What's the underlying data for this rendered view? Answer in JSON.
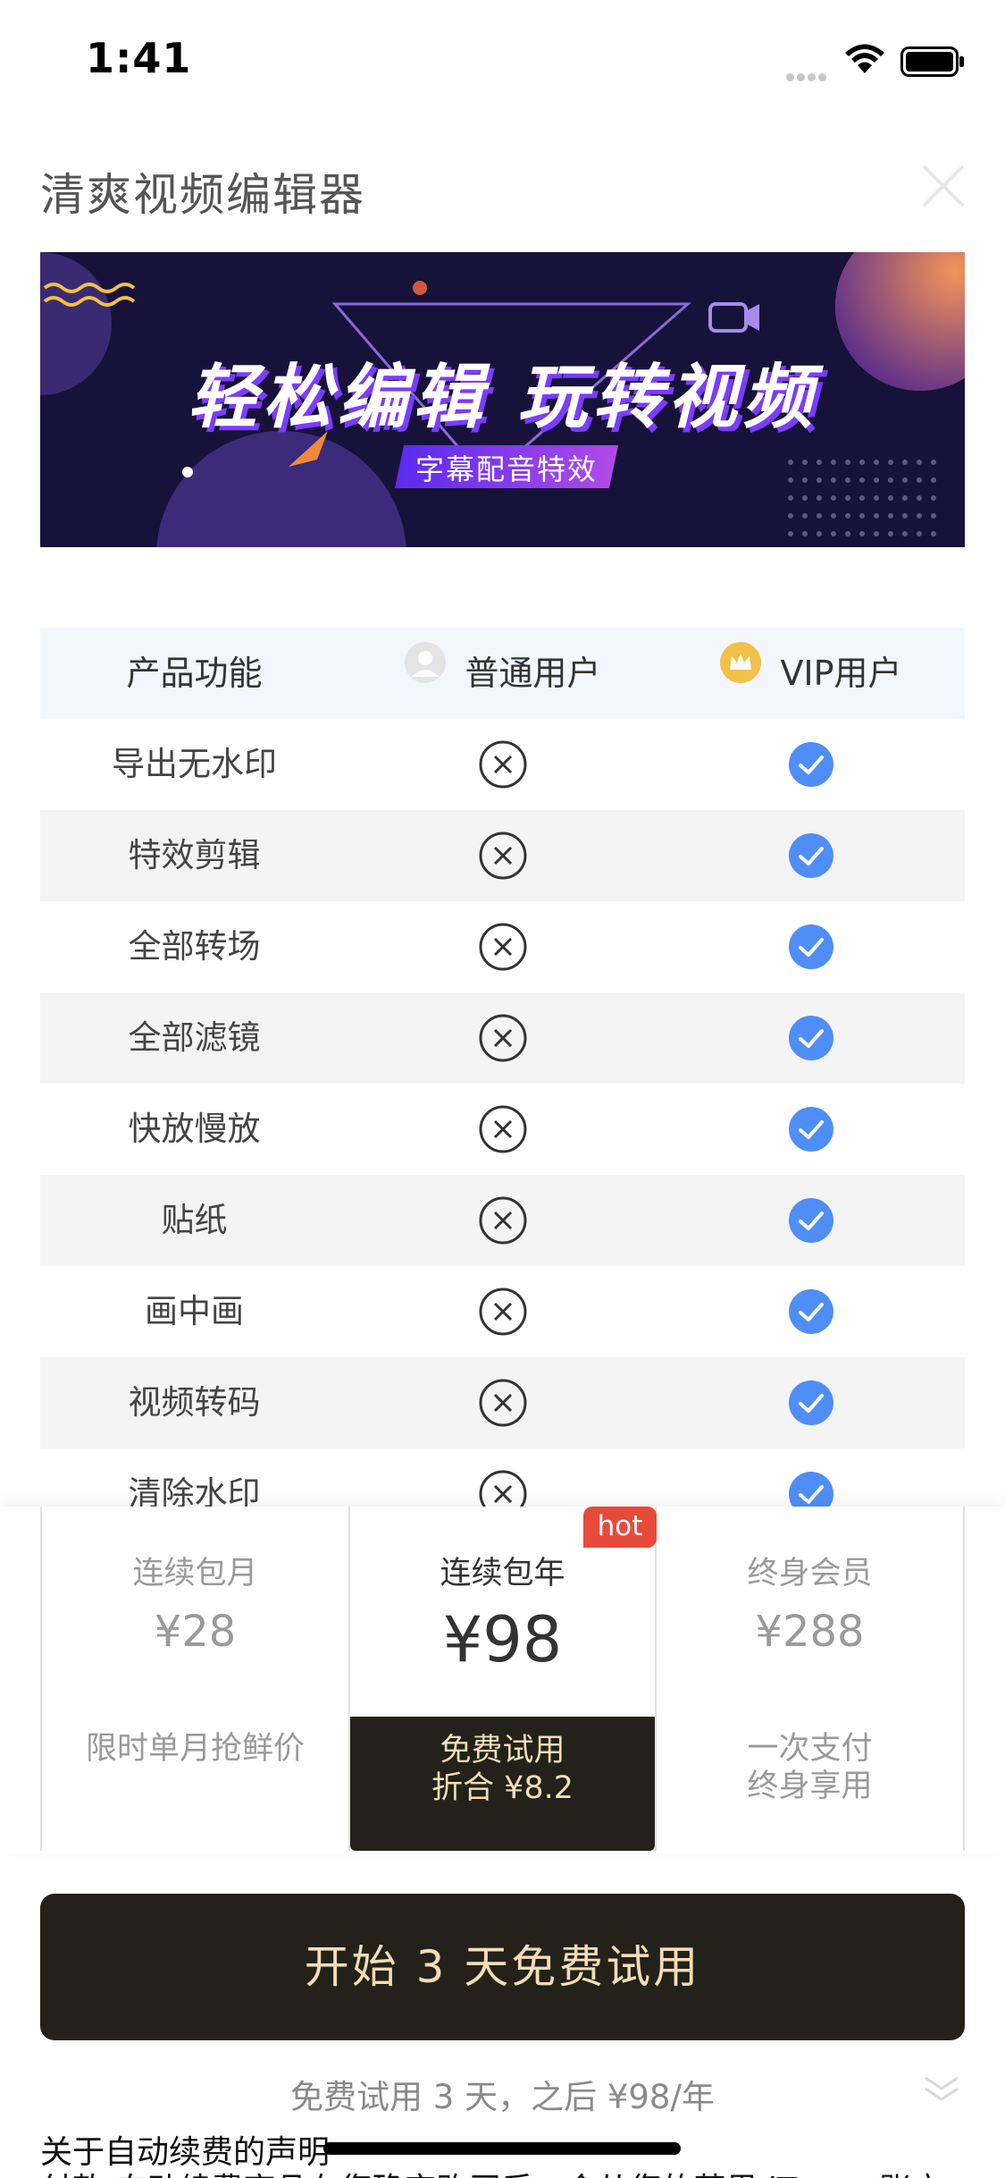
{
  "status": {
    "time": "1:41"
  },
  "header": {
    "title": "清爽视频编辑器"
  },
  "banner": {
    "headline": "轻松编辑 玩转视频",
    "tag": "字幕配音特效"
  },
  "table": {
    "headers": {
      "feature": "产品功能",
      "normal": "普通用户",
      "vip": "VIP用户"
    },
    "rows": [
      {
        "feature": "导出无水印"
      },
      {
        "feature": "特效剪辑"
      },
      {
        "feature": "全部转场"
      },
      {
        "feature": "全部滤镜"
      },
      {
        "feature": "快放慢放"
      },
      {
        "feature": "贴纸"
      },
      {
        "feature": "画中画"
      },
      {
        "feature": "视频转码"
      },
      {
        "feature": "清除水印"
      }
    ]
  },
  "plans": {
    "monthly": {
      "name": "连续包月",
      "price": "¥28",
      "note": "限时单月抢鲜价"
    },
    "yearly": {
      "name": "连续包年",
      "price": "¥98",
      "note_line1": "免费试用",
      "note_line2": "折合 ¥8.2",
      "badge": "hot"
    },
    "lifetime": {
      "name": "终身会员",
      "price": "¥288",
      "note_line1": "一次支付",
      "note_line2": "终身享用"
    }
  },
  "cta": {
    "label": "开始 3 天免费试用"
  },
  "trial_text": "免费试用 3 天，之后 ¥98/年",
  "disclaimer": {
    "title": "关于自动续费的声明",
    "body": "付款 自动续费商品在您确定购买后，会从您的苹果 iTunes 账户"
  },
  "colors": {
    "accent_blue": "#4f8ef7",
    "dark": "#232119",
    "gold_text": "#f3ddb6",
    "hot_red": "#e84a3a"
  }
}
